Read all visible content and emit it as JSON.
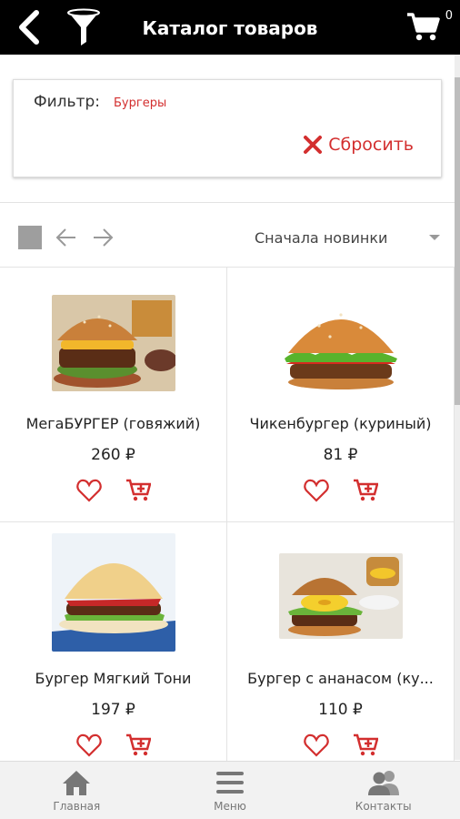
{
  "header": {
    "title": "Каталог товаров",
    "cart_count": "0",
    "icons": [
      "back-arrow-icon",
      "filter-funnel-icon",
      "cart-icon"
    ]
  },
  "filter": {
    "label": "Фильтр:",
    "value": "Бургеры",
    "reset_label": "Сбросить"
  },
  "toolbar": {
    "sort_label": "Сначала новинки"
  },
  "products": [
    {
      "name": "МегаБУРГЕР (говяжий)",
      "price": "260 ₽"
    },
    {
      "name": "Чикенбургер (куриный)",
      "price": "81 ₽"
    },
    {
      "name": "Бургер Мягкий Тони",
      "price": "197 ₽"
    },
    {
      "name": "Бургер с ананасом (ку...",
      "price": "110 ₽"
    }
  ],
  "bottom_nav": {
    "items": [
      {
        "label": "Главная",
        "icon": "home-icon"
      },
      {
        "label": "Меню",
        "icon": "menu-icon"
      },
      {
        "label": "Контакты",
        "icon": "contacts-icon"
      }
    ]
  },
  "colors": {
    "header_bg": "#000000",
    "accent_red": "#d32f2f",
    "bottom_nav_bg": "#f2f2f2"
  }
}
